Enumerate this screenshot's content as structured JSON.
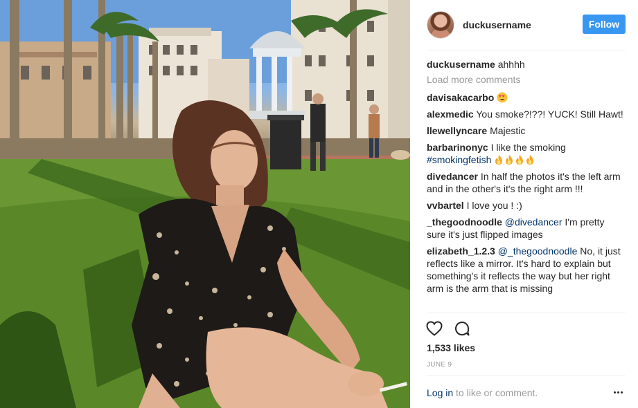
{
  "post": {
    "photo_alt": "",
    "author": "duckusername",
    "follow_label": "Follow"
  },
  "caption": {
    "user": "duckusername",
    "text": "ahhhh"
  },
  "load_more_label": "Load more comments",
  "comments": [
    {
      "user": "davisakacarbo",
      "text": "",
      "emoji": "heart-eyes-emoji"
    },
    {
      "user": "alexmedic",
      "text": "You smoke?!??! YUCK! Still Hawt!"
    },
    {
      "user": "llewellyncare",
      "text": "Majestic"
    },
    {
      "user": "barbarinonyc",
      "text": "I like the smoking",
      "hashtag": "#smokingfetish",
      "emoji": "fire-emoji x4"
    },
    {
      "user": "divedancer",
      "text": "In half the photos it's the left arm and in the other's it's the right arm !!!"
    },
    {
      "user": "vvbartel",
      "text": "I love you ! :)"
    },
    {
      "user": "_thegoodnoodle",
      "mention": "@divedancer",
      "text": "I'm pretty sure it's just flipped images"
    },
    {
      "user": "elizabeth_1.2.3",
      "mention": "@_thegoodnoodle",
      "text": "No, it just reflects like a mirror. It's hard to explain but something's it reflects the way but her right arm is the arm that is missing"
    }
  ],
  "actions": {
    "like_icon": "heart-outline-icon",
    "comment_icon": "speech-bubble-icon"
  },
  "likes_text": "1,533 likes",
  "date_text": "JUNE 9",
  "footer": {
    "login_label": "Log in",
    "login_suffix": " to like or comment.",
    "more_icon": "more-options-icon"
  },
  "colors": {
    "follow_button": "#3897f0",
    "link": "#003569",
    "muted": "#999999",
    "text": "#262626",
    "divider": "#efefef"
  }
}
